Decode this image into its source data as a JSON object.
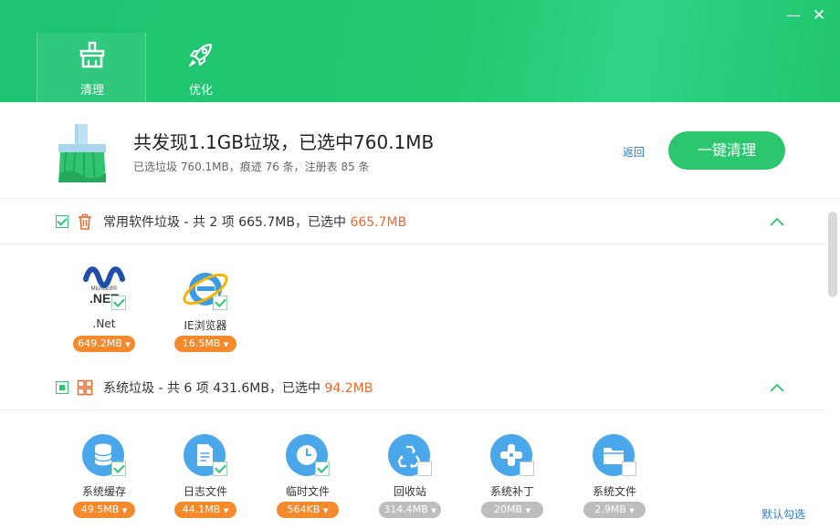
{
  "window": {
    "minimize": "—",
    "close": "✕"
  },
  "tabs": [
    {
      "label": "清理",
      "icon": "broom-icon",
      "active": true
    },
    {
      "label": "优化",
      "icon": "rocket-icon",
      "active": false
    }
  ],
  "summary": {
    "title": "共发现1.1GB垃圾，已选中760.1MB",
    "subtitle": "已选垃圾 760.1MB，痕迹 76 条，注册表 85 条",
    "back": "返回",
    "clean_button": "一键清理"
  },
  "sections": [
    {
      "title_prefix": "常用软件垃圾 - 共 2 项 665.7MB，已选中 ",
      "title_highlight": "665.7MB",
      "checkbox": "checked",
      "icon": "trash-icon",
      "items": [
        {
          "name": ".Net",
          "size": "649.2MB",
          "checked": true,
          "icon": "dotnet-icon"
        },
        {
          "name": "IE浏览器",
          "size": "16.5MB",
          "checked": true,
          "icon": "ie-icon"
        }
      ]
    },
    {
      "title_prefix": "系统垃圾 - 共 6 项 431.6MB，已选中 ",
      "title_highlight": "94.2MB",
      "checkbox": "partial",
      "icon": "windows-icon",
      "items": [
        {
          "name": "系统缓存",
          "size": "49.5MB",
          "checked": true,
          "icon": "database-icon"
        },
        {
          "name": "日志文件",
          "size": "44.1MB",
          "checked": true,
          "icon": "document-icon"
        },
        {
          "name": "临时文件",
          "size": "564KB",
          "checked": true,
          "icon": "clock-icon"
        },
        {
          "name": "回收站",
          "size": "314.4MB",
          "checked": false,
          "icon": "recycle-icon"
        },
        {
          "name": "系统补丁",
          "size": "20MB",
          "checked": false,
          "icon": "patch-icon"
        },
        {
          "name": "系统文件",
          "size": "2.9MB",
          "checked": false,
          "icon": "folder-icon"
        }
      ]
    }
  ],
  "footer": {
    "default_select": "默认勾选"
  },
  "colors": {
    "brand": "#22c96f",
    "highlight": "#f0682a",
    "link": "#2a7bd6",
    "size_badge": "#f58a2c"
  }
}
